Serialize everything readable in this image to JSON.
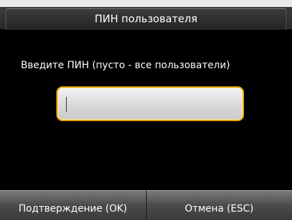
{
  "header": {
    "title": "ПИН пользователя"
  },
  "dialog": {
    "prompt": "Введите ПИН (пусто - все пользователи)",
    "pin_value": ""
  },
  "softkeys": {
    "confirm_label": "Подтверждение (OK)",
    "cancel_label": "Отмена (ESC)"
  },
  "colors": {
    "background": "#000000",
    "input_border": "#e6a400",
    "title_text": "#ffffff"
  }
}
